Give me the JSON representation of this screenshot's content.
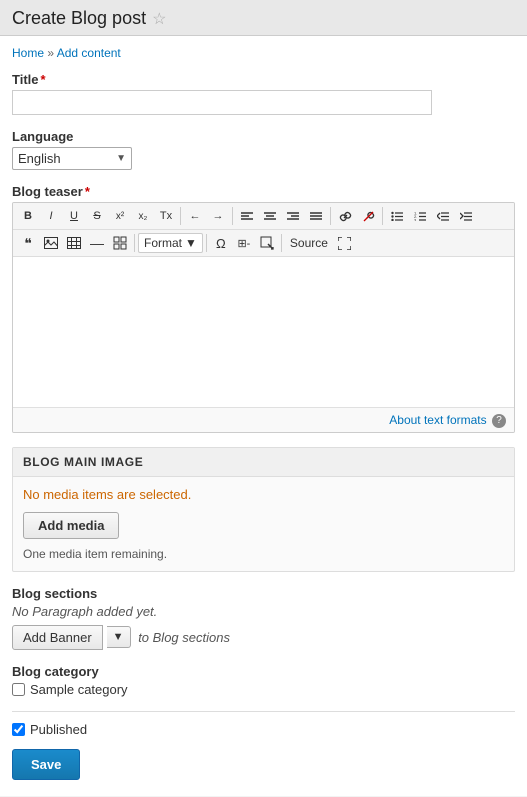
{
  "pageHeader": {
    "title": "Create Blog post",
    "starLabel": "☆"
  },
  "breadcrumb": {
    "home": "Home",
    "separator1": "»",
    "addContent": "Add content"
  },
  "titleField": {
    "label": "Title",
    "required": true,
    "placeholder": ""
  },
  "languageField": {
    "label": "Language",
    "value": "English"
  },
  "blogTeaserField": {
    "label": "Blog teaser",
    "required": true
  },
  "toolbar": {
    "boldLabel": "B",
    "italicLabel": "I",
    "underlineLabel": "U",
    "strikeLabel": "S",
    "superLabel": "x²",
    "subLabel": "x₂",
    "removeFormatLabel": "Tx",
    "undoLabel": "←",
    "redoLabel": "→",
    "alignLeft": "≡",
    "alignCenter": "≡",
    "alignRight": "≡",
    "alignJustify": "≡",
    "linkLabel": "🔗",
    "unlinkLabel": "🔗",
    "unorderedList": "≔",
    "orderedList": "≔",
    "outdent": "←≡",
    "indent": "≡→",
    "blockquote": "❝",
    "image": "🖼",
    "table": "⊞",
    "hr": "—",
    "specialChar": "▦",
    "formatLabel": "Format",
    "omega": "Ω",
    "tableEdit": "⊞-",
    "resize": "⤢",
    "sourceLabel": "Source",
    "fullscreen": "⤢"
  },
  "aboutTextFormats": {
    "linkLabel": "About text formats",
    "helpIcon": "?"
  },
  "blogMainImage": {
    "sectionTitle": "BLOG MAIN IMAGE",
    "noMediaMessage": "No media items are selected.",
    "addMediaButton": "Add media",
    "remainingMessage": "One media item remaining."
  },
  "blogSections": {
    "label": "Blog sections",
    "noParagraph": "No Paragraph added yet.",
    "addBannerButton": "Add Banner",
    "toSectionsLabel": "to Blog sections"
  },
  "blogCategory": {
    "label": "Blog category",
    "sampleCategoryLabel": "Sample category",
    "sampleCategoryChecked": false
  },
  "publishedField": {
    "label": "Published",
    "checked": true
  },
  "saveButton": {
    "label": "Save"
  }
}
